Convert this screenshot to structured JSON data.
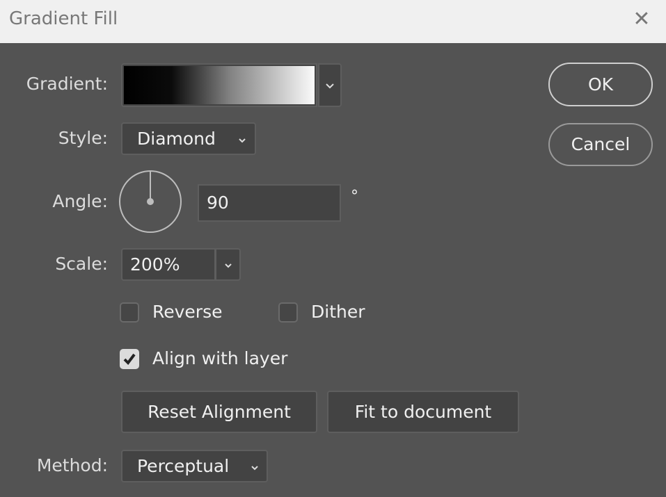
{
  "window": {
    "title": "Gradient Fill",
    "close_icon": "close-icon"
  },
  "labels": {
    "gradient": "Gradient:",
    "style": "Style:",
    "angle": "Angle:",
    "scale": "Scale:",
    "method": "Method:"
  },
  "gradient": {
    "stops": [
      "#000000",
      "#ffffff"
    ]
  },
  "style": {
    "value": "Diamond"
  },
  "angle": {
    "value": "90",
    "unit": "°"
  },
  "scale": {
    "value": "200%"
  },
  "checkboxes": {
    "reverse": {
      "label": "Reverse",
      "checked": false
    },
    "dither": {
      "label": "Dither",
      "checked": false
    },
    "align": {
      "label": "Align with layer",
      "checked": true
    }
  },
  "buttons": {
    "reset": "Reset Alignment",
    "fit": "Fit to document",
    "ok": "OK",
    "cancel": "Cancel"
  },
  "method": {
    "value": "Perceptual"
  }
}
